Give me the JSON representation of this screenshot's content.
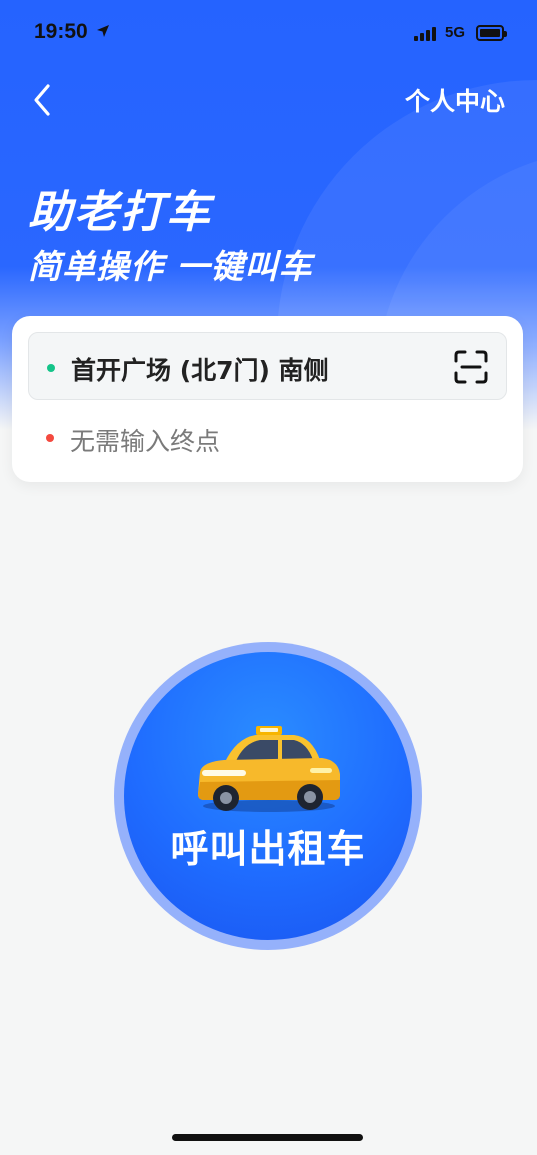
{
  "status_bar": {
    "time": "19:50",
    "network": "5G"
  },
  "header": {
    "back_icon": "chevron-left-icon",
    "personal_center": "个人中心",
    "title": "助老打车",
    "subtitle": "简单操作 一键叫车"
  },
  "address": {
    "from": "首开广场 (北7门) 南侧",
    "to_placeholder": "无需输入终点",
    "scan_icon": "scan-icon"
  },
  "call": {
    "label": "呼叫出租车",
    "icon": "taxi-icon"
  },
  "colors": {
    "primary": "#2563ff",
    "from_dot": "#14c489",
    "to_dot": "#f4493f"
  }
}
